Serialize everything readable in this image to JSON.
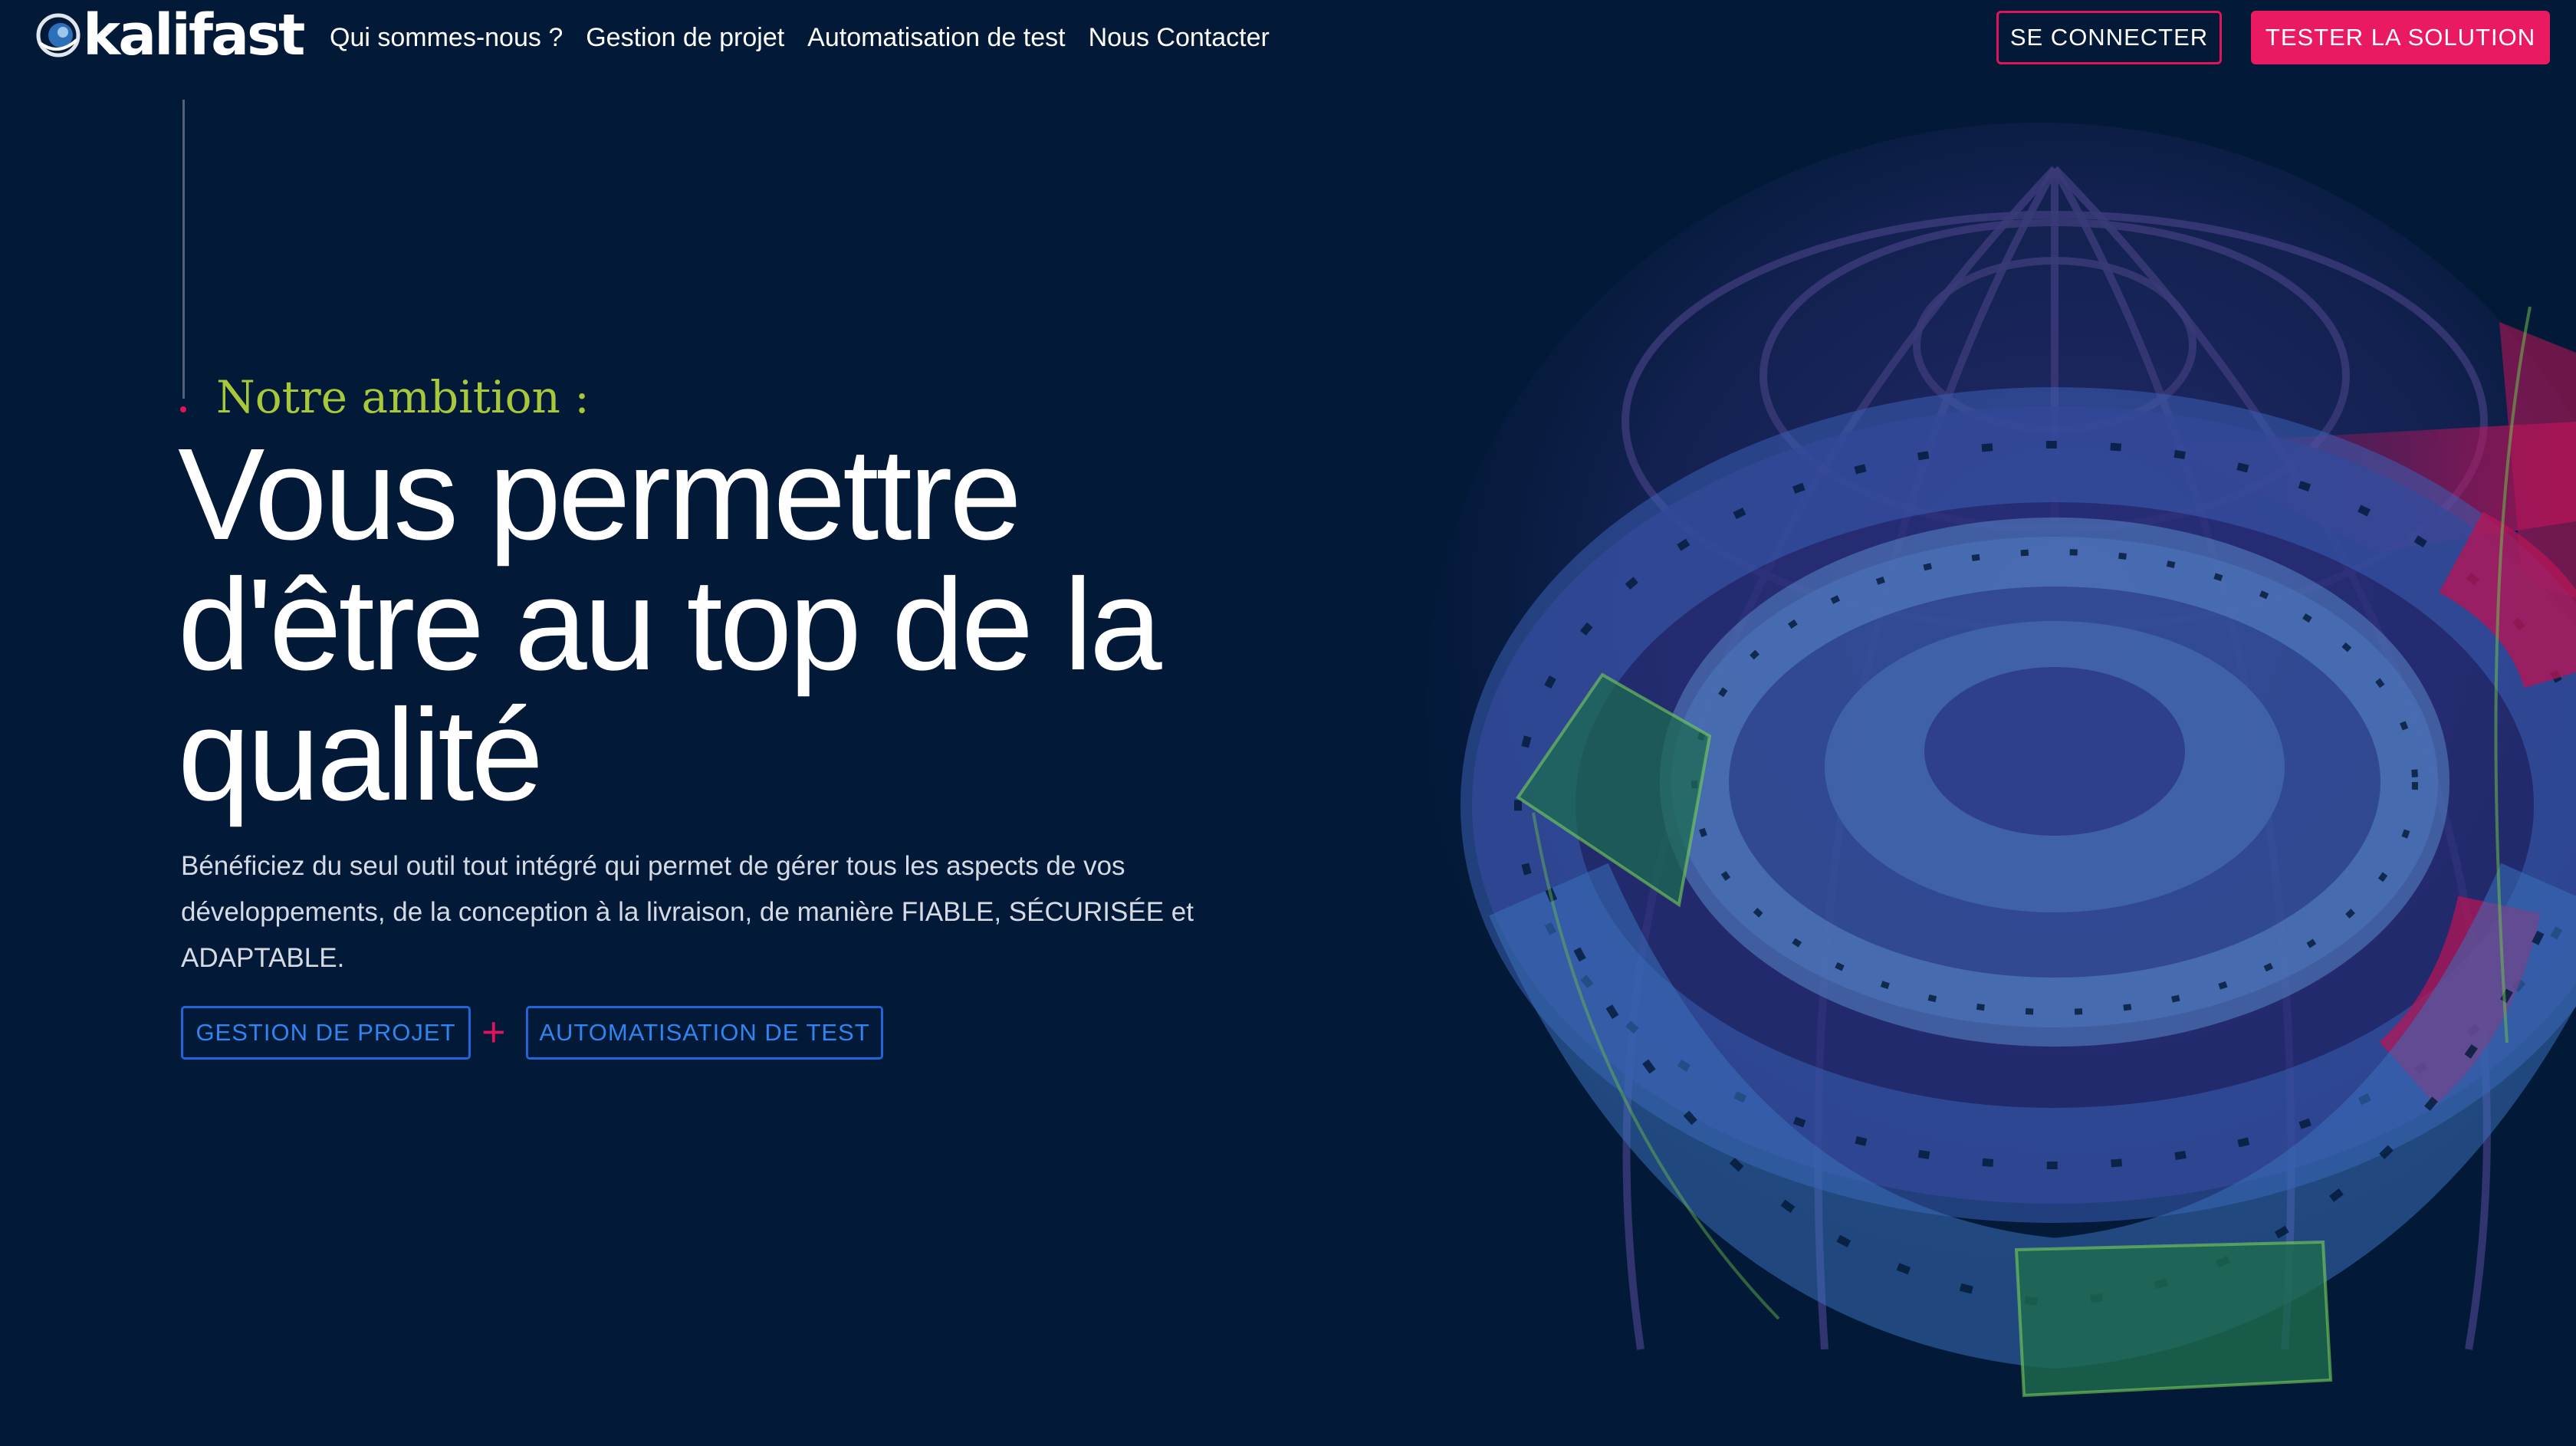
{
  "brand": {
    "name": "kalifast"
  },
  "nav": {
    "items": [
      {
        "label": "Qui sommes-nous ?"
      },
      {
        "label": "Gestion de projet"
      },
      {
        "label": "Automatisation de test"
      },
      {
        "label": "Nous Contacter"
      }
    ]
  },
  "header_actions": {
    "login_label": "SE CONNECTER",
    "try_label": "TESTER LA SOLUTION"
  },
  "hero": {
    "kicker": "Notre ambition :",
    "headline_lines": [
      "Vous permettre",
      "d'être au top de la",
      "qualité"
    ],
    "description": "Bénéficiez du seul outil tout intégré qui permet de gérer tous les aspects de vos développements, de la conception à la livraison, de manière FIABLE, SÉCURISÉE et ADAPTABLE.",
    "buttons": {
      "project_label": "GESTION DE PROJET",
      "plus": "+",
      "automation_label": "AUTOMATISATION DE TEST"
    }
  },
  "colors": {
    "background": "#021937",
    "accent_pink": "#ea1a62",
    "kicker_green": "#a7c83a",
    "outline_blue": "#2166d8"
  },
  "illustration": {
    "name": "wireframe-globe-illustration"
  }
}
